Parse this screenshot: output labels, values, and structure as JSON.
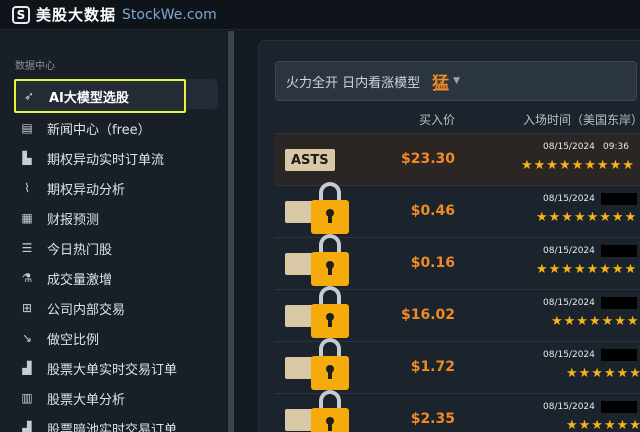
{
  "header": {
    "brand_cn": "美股大数据",
    "brand_en": "StockWe.com",
    "logo_letter": "S"
  },
  "sidebar": {
    "section_title": "数据中心",
    "items": [
      {
        "label": "AI大模型选股",
        "icon": "rocket-icon",
        "glyph": "➶",
        "active": true
      },
      {
        "label": "新闻中心（free）",
        "icon": "news-icon",
        "glyph": "▤"
      },
      {
        "label": "期权异动实时订单流",
        "icon": "bar-chart-icon",
        "glyph": "▙"
      },
      {
        "label": "期权异动分析",
        "icon": "line-chart-icon",
        "glyph": "⌇"
      },
      {
        "label": "财报预测",
        "icon": "calendar-icon",
        "glyph": "▦"
      },
      {
        "label": "今日热门股",
        "icon": "list-icon",
        "glyph": "☰"
      },
      {
        "label": "成交量激增",
        "icon": "flask-icon",
        "glyph": "⚗"
      },
      {
        "label": "公司内部交易",
        "icon": "org-icon",
        "glyph": "⊞"
      },
      {
        "label": "做空比例",
        "icon": "trend-down-icon",
        "glyph": "↘"
      },
      {
        "label": "股票大单实时交易订单",
        "icon": "factory-icon",
        "glyph": "▟"
      },
      {
        "label": "股票大单分析",
        "icon": "analysis-icon",
        "glyph": "▥"
      },
      {
        "label": "股票暗池实时交易订单",
        "icon": "factory-icon",
        "glyph": "▟"
      }
    ]
  },
  "main": {
    "filter": {
      "label": "火力全开 日内看涨模型",
      "selected": "猛"
    },
    "columns": {
      "price": "买入价",
      "time": "入场时间（美国东岸）"
    },
    "rows": [
      {
        "ticker": "ASTS",
        "price": "$23.30",
        "date": "08/15/2024",
        "time": "09:36",
        "stars": 9,
        "locked": false
      },
      {
        "ticker": "",
        "price": "$0.46",
        "date": "08/15/2024",
        "time": "",
        "stars": 8,
        "locked": true
      },
      {
        "ticker": "",
        "price": "$0.16",
        "date": "08/15/2024",
        "time": "",
        "stars": 8,
        "locked": true
      },
      {
        "ticker": "",
        "price": "$16.02",
        "date": "08/15/2024",
        "time": "",
        "stars": 7,
        "locked": true
      },
      {
        "ticker": "",
        "price": "$1.72",
        "date": "08/15/2024",
        "time": "",
        "stars": 6,
        "locked": true
      },
      {
        "ticker": "",
        "price": "$2.35",
        "date": "08/15/2024",
        "time": "",
        "stars": 6,
        "locked": true
      }
    ]
  },
  "colors": {
    "accent": "#f08a24",
    "star": "#f5b417",
    "lock": "#f5ab0b",
    "highlight": "#e4f53a"
  }
}
